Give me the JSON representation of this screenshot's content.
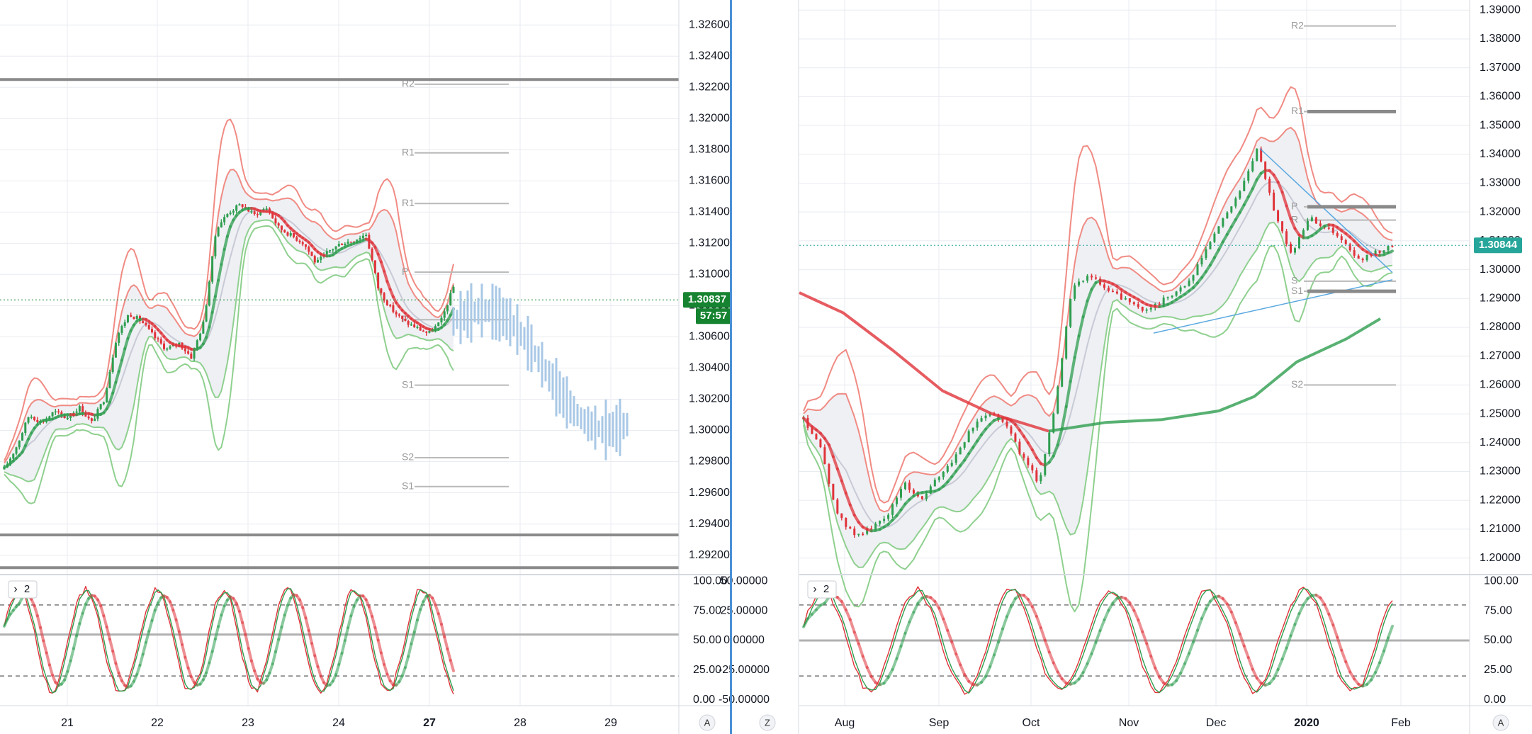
{
  "colors": {
    "up": "#2e9e4f",
    "down": "#e0333a",
    "bb_upper": "#f08b84",
    "bb_lower": "#8fd08f",
    "bb_fill": "#eef0f4",
    "ma": "#c8cad6",
    "pivot": "#b9b9b9",
    "heavy": "#8a8a8a",
    "projection": "#a9c8e6",
    "trend": "#5aa8e0",
    "price_bg_left": "#15832f",
    "price_bg_right": "#26a69a",
    "grid": "#e8ebf0",
    "axis_text": "#131722",
    "divider": "#4a8fd6"
  },
  "chart_data": [
    {
      "type": "candlestick",
      "pane": "left-hourly",
      "x_tick_labels": [
        "21",
        "22",
        "23",
        "24",
        "27",
        "28",
        "29"
      ],
      "y_tick_labels": [
        "1.32600",
        "1.32400",
        "1.32200",
        "1.32000",
        "1.31800",
        "1.31600",
        "1.31400",
        "1.31200",
        "1.31000",
        "1.30800",
        "1.30600",
        "1.30400",
        "1.30200",
        "1.30000",
        "1.29800",
        "1.29600",
        "1.29400",
        "1.29200"
      ],
      "y_range": [
        1.2908,
        1.3276
      ],
      "current_price": "1.30837",
      "countdown": "57:57",
      "series_close": [
        1.2975,
        1.299,
        1.301,
        1.3005,
        1.3012,
        1.3008,
        1.3015,
        1.3005,
        1.302,
        1.306,
        1.3075,
        1.307,
        1.306,
        1.3052,
        1.3056,
        1.3047,
        1.307,
        1.313,
        1.314,
        1.3145,
        1.3138,
        1.3143,
        1.313,
        1.3125,
        1.312,
        1.3107,
        1.3115,
        1.312,
        1.3122,
        1.3126,
        1.309,
        1.3078,
        1.307,
        1.3066,
        1.3062,
        1.307,
        1.3092
      ],
      "pivot_levels": [
        {
          "label": "R2",
          "value": 1.3222
        },
        {
          "label": "R1",
          "value": 1.3178
        },
        {
          "label": "R1",
          "value": 1.31455
        },
        {
          "label": "P",
          "value": 1.31015
        },
        {
          "label": "P",
          "value": 1.3071
        },
        {
          "label": "S1",
          "value": 1.3029
        },
        {
          "label": "S2",
          "value": 1.29825
        },
        {
          "label": "S1",
          "value": 1.2964
        }
      ],
      "heavy_levels": [
        1.3225,
        1.2933,
        1.2912
      ],
      "oscillator": {
        "input_label": "2",
        "y_tick_labels": [
          "100.00",
          "75.00",
          "50.00",
          "25.00",
          "0.00"
        ],
        "y_range": [
          -5,
          105
        ],
        "dashed_levels": [
          80,
          20
        ],
        "solid_level": 55
      }
    },
    {
      "type": "candlestick",
      "pane": "right-daily",
      "x_tick_labels": [
        "Aug",
        "Sep",
        "Oct",
        "Nov",
        "Dec",
        "2020",
        "Feb"
      ],
      "y_tick_labels": [
        "1.39000",
        "1.38000",
        "1.37000",
        "1.36000",
        "1.35000",
        "1.34000",
        "1.33000",
        "1.32000",
        "1.31000",
        "1.30000",
        "1.29000",
        "1.28000",
        "1.27000",
        "1.26000",
        "1.25000",
        "1.24000",
        "1.23000",
        "1.22000",
        "1.21000",
        "1.20000"
      ],
      "y_range": [
        1.1945,
        1.3935
      ],
      "current_price": "1.30844",
      "series_close": [
        1.248,
        1.238,
        1.215,
        1.208,
        1.21,
        1.215,
        1.226,
        1.22,
        1.228,
        1.235,
        1.245,
        1.251,
        1.247,
        1.235,
        1.226,
        1.255,
        1.295,
        1.298,
        1.293,
        1.29,
        1.286,
        1.288,
        1.292,
        1.296,
        1.308,
        1.318,
        1.328,
        1.342,
        1.32,
        1.305,
        1.318,
        1.315,
        1.31,
        1.303,
        1.306,
        1.3084
      ],
      "pivot_levels": [
        {
          "label": "R2",
          "value": 1.3845
        },
        {
          "label": "R1",
          "value": 1.3548
        },
        {
          "label": "P",
          "value": 1.3218
        },
        {
          "label": "S1",
          "value": 1.2925
        },
        {
          "label": "S2",
          "value": 1.26
        },
        {
          "label": "R",
          "value": 1.3172
        },
        {
          "label": "S",
          "value": 1.296
        }
      ],
      "oscillator": {
        "input_label": "2",
        "y_tick_labels": [
          "50.00000",
          "25.00000",
          "0.00000",
          "-25.00000",
          "-50.00000"
        ],
        "y_tick_labels_right": [
          "100.00",
          "75.00",
          "50.00",
          "25.00",
          "0.00"
        ],
        "y_range": [
          -5,
          105
        ],
        "dashed_levels": [
          80,
          20
        ],
        "solid_level": 50
      }
    }
  ],
  "corner_buttons": {
    "left_auto": "A",
    "right_zoom": "Z",
    "right_auto": "A"
  }
}
